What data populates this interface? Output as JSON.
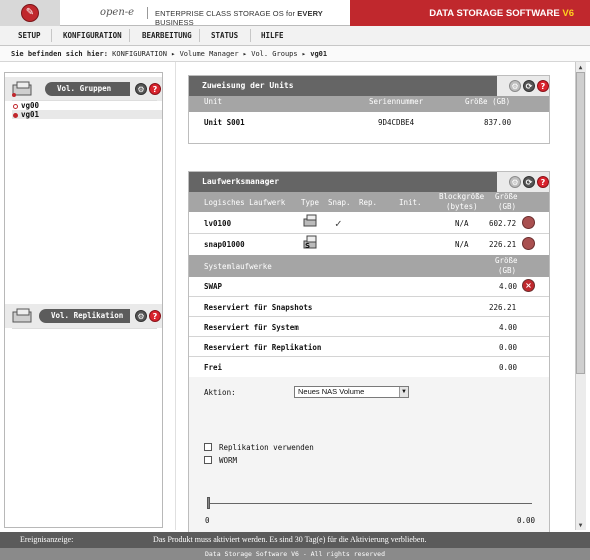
{
  "header": {
    "brand": "open-e",
    "tagline_prefix": "ENTERPRISE CLASS STORAGE OS for ",
    "tagline_em": "EVERY",
    "tagline_suffix": " BUSINESS",
    "product": "DATA STORAGE SOFTWARE ",
    "product_version": "V6"
  },
  "nav": [
    "SETUP",
    "KONFIGURATION",
    "BEARBEITUNG",
    "STATUS",
    "HILFE"
  ],
  "breadcrumb": {
    "prefix": "Sie befinden sich hier:",
    "path": " KONFIGURATION ▸ Volume Manager ▸ Vol. Groups ▸ ",
    "current": "vg01"
  },
  "left_panel": {
    "groups_title": "Vol. Gruppen",
    "groups": [
      "vg00",
      "vg01"
    ],
    "selected_group": "vg01",
    "replication_title": "Vol. Replikation"
  },
  "units_panel": {
    "title": "Zuweisung der Units",
    "columns": [
      "Unit",
      "Seriennummer",
      "Größe (GB)"
    ],
    "rows": [
      {
        "unit": "Unit S001",
        "serial": "9D4CDBE4",
        "size": "837.00"
      }
    ]
  },
  "drive_panel": {
    "title": "Laufwerksmanager",
    "columns": {
      "logical": "Logisches Laufwerk",
      "type": "Type",
      "snap": "Snap.",
      "rep": "Rep.",
      "init": "Init.",
      "block": "Blockgröße",
      "block_unit": "(bytes)",
      "size": "Größe",
      "size_unit": "(GB)"
    },
    "logical_drives": [
      {
        "name": "lv0100",
        "type_icon": "nas-volume-icon",
        "snap": "✓",
        "block": "N/A",
        "size": "602.72"
      },
      {
        "name": "snap01000",
        "type_icon": "snapshot-icon",
        "snap": "",
        "block": "N/A",
        "size": "226.21"
      }
    ],
    "system_header": "Systemlaufwerke",
    "system_size_label": "Größe",
    "system_size_unit": "(GB)",
    "system_drives": [
      {
        "name": "SWAP",
        "size": "4.00"
      },
      {
        "name": "Reserviert für Snapshots",
        "size": "226.21"
      },
      {
        "name": "Reserviert für System",
        "size": "4.00"
      },
      {
        "name": "Reserviert für Replikation",
        "size": "0.00"
      },
      {
        "name": "Frei",
        "size": "0.00"
      }
    ],
    "action_label": "Aktion:",
    "action_value": "Neues NAS Volume",
    "replication_checkbox": "Replikation verwenden",
    "worm_checkbox": "WORM",
    "slider_min": "0",
    "slider_max": "0.00",
    "slider_value": 0
  },
  "status_bar": {
    "label": "Ereignisanzeige:",
    "message": "Das Produkt muss aktiviert werden. Es sind 30 Tag(e) für die Aktivierung verblieben."
  },
  "footer": "Data Storage Software V6 - All rights reserved",
  "colors": {
    "brand_red": "#c0282d",
    "panel_head": "#656565",
    "column_head": "#a5a5a5"
  }
}
